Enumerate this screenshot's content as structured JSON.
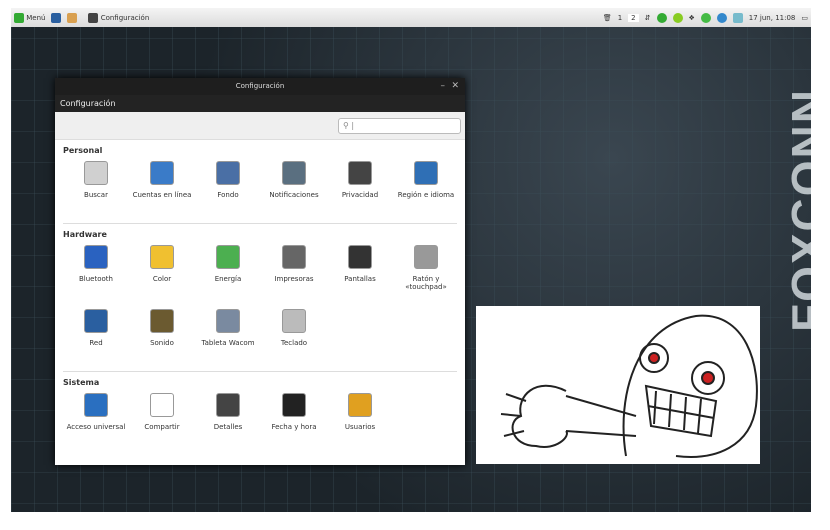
{
  "panel": {
    "menu_label": "Menú",
    "task_label": "Configuración",
    "workspaces": [
      "1",
      "2"
    ],
    "clock": "17 jun, 11:08"
  },
  "desktop": {
    "brand": "FOXCONN"
  },
  "window": {
    "title": "Configuración",
    "menu_title": "Configuración",
    "search_placeholder": "",
    "sections": [
      {
        "title": "Personal",
        "items": [
          {
            "label": "Buscar",
            "icon": "search-icon",
            "color": "#d0d0d0"
          },
          {
            "label": "Cuentas en línea",
            "icon": "online-accounts-icon",
            "color": "#3a7bc8"
          },
          {
            "label": "Fondo",
            "icon": "background-icon",
            "color": "#4a6fa5"
          },
          {
            "label": "Notificaciones",
            "icon": "notifications-icon",
            "color": "#5a6f80"
          },
          {
            "label": "Privacidad",
            "icon": "privacy-icon",
            "color": "#444444"
          },
          {
            "label": "Región e idioma",
            "icon": "globe-icon",
            "color": "#2f6fb5"
          }
        ]
      },
      {
        "title": "Hardware",
        "items": [
          {
            "label": "Bluetooth",
            "icon": "bluetooth-icon",
            "color": "#2a62c0"
          },
          {
            "label": "Color",
            "icon": "color-icon",
            "color": "#f0c030"
          },
          {
            "label": "Energía",
            "icon": "battery-icon",
            "color": "#4caf50"
          },
          {
            "label": "Impresoras",
            "icon": "printer-icon",
            "color": "#666666"
          },
          {
            "label": "Pantallas",
            "icon": "display-icon",
            "color": "#333333"
          },
          {
            "label": "Ratón y «touchpad»",
            "icon": "mouse-icon",
            "color": "#999999"
          },
          {
            "label": "Red",
            "icon": "network-icon",
            "color": "#2a5fa0"
          },
          {
            "label": "Sonido",
            "icon": "sound-icon",
            "color": "#6b5a30"
          },
          {
            "label": "Tableta Wacom",
            "icon": "tablet-icon",
            "color": "#7a8aa0"
          },
          {
            "label": "Teclado",
            "icon": "keyboard-icon",
            "color": "#bbbbbb"
          }
        ]
      },
      {
        "title": "Sistema",
        "items": [
          {
            "label": "Acceso universal",
            "icon": "accessibility-icon",
            "color": "#2a6fc0"
          },
          {
            "label": "Compartir",
            "icon": "share-icon",
            "color": "#ffffff"
          },
          {
            "label": "Detalles",
            "icon": "details-icon",
            "color": "#444444"
          },
          {
            "label": "Fecha y hora",
            "icon": "clock-icon",
            "color": "#222222"
          },
          {
            "label": "Usuarios",
            "icon": "users-icon",
            "color": "#e0a020"
          }
        ]
      }
    ]
  }
}
